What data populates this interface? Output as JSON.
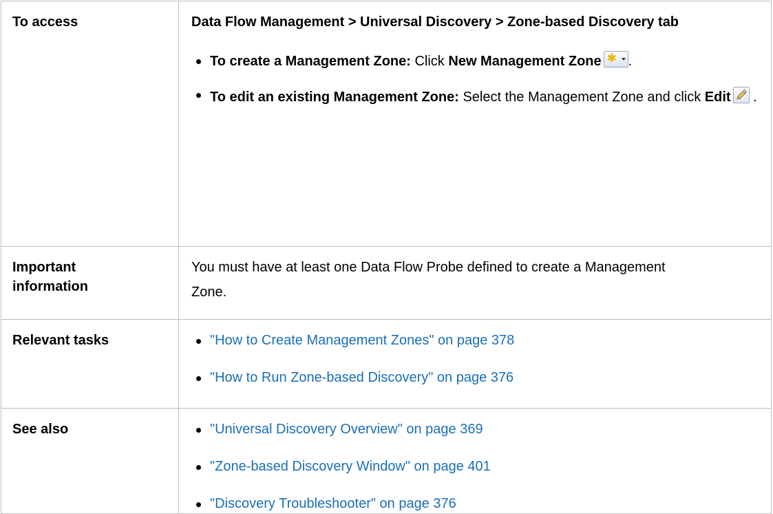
{
  "access": {
    "label": "To access",
    "path": "Data Flow Management > Universal Discovery > Zone-based Discovery tab",
    "create": {
      "lead": "To create a Management Zone:",
      "text": " Click ",
      "action": "New Management Zone",
      "icon": "new-management-zone-icon",
      "end": "."
    },
    "edit": {
      "lead": "To edit an existing Management Zone:",
      "text": " Select the Management Zone and click ",
      "action": "Edit",
      "icon": "edit-pencil-icon",
      "end": "."
    }
  },
  "important": {
    "label": "Important information",
    "text": "You must have at least one Data Flow Probe defined to create a Management Zone."
  },
  "tasks": {
    "label": "Relevant tasks",
    "links": [
      "\"How to Create Management Zones\" on page 378",
      "\"How to Run Zone-based Discovery\" on page 376"
    ]
  },
  "see_also": {
    "label": "See also",
    "links": [
      "\"Universal Discovery Overview\" on page 369",
      "\"Zone-based Discovery Window\" on page 401",
      "\"Discovery Troubleshooter\" on page 376"
    ]
  },
  "colors": {
    "link": "#1a6fb8",
    "border": "#bcbcbc"
  }
}
